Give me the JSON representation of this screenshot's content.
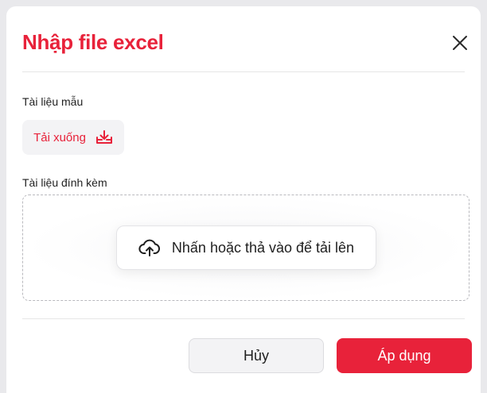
{
  "dialog": {
    "title": "Nhập file excel",
    "close_icon": "close-icon"
  },
  "template_section": {
    "label": "Tài liệu mẫu",
    "download_label": "Tải xuống",
    "download_icon": "download-tray-icon"
  },
  "attachment_section": {
    "label": "Tài liệu đính kèm",
    "upload_label": "Nhấn hoặc thả vào để tải lên",
    "upload_icon": "cloud-upload-icon"
  },
  "footer": {
    "cancel_label": "Hủy",
    "apply_label": "Áp dụng"
  },
  "colors": {
    "accent": "#e8223a",
    "text": "#1f1f1f",
    "muted_button_bg": "#f3f3f5"
  }
}
